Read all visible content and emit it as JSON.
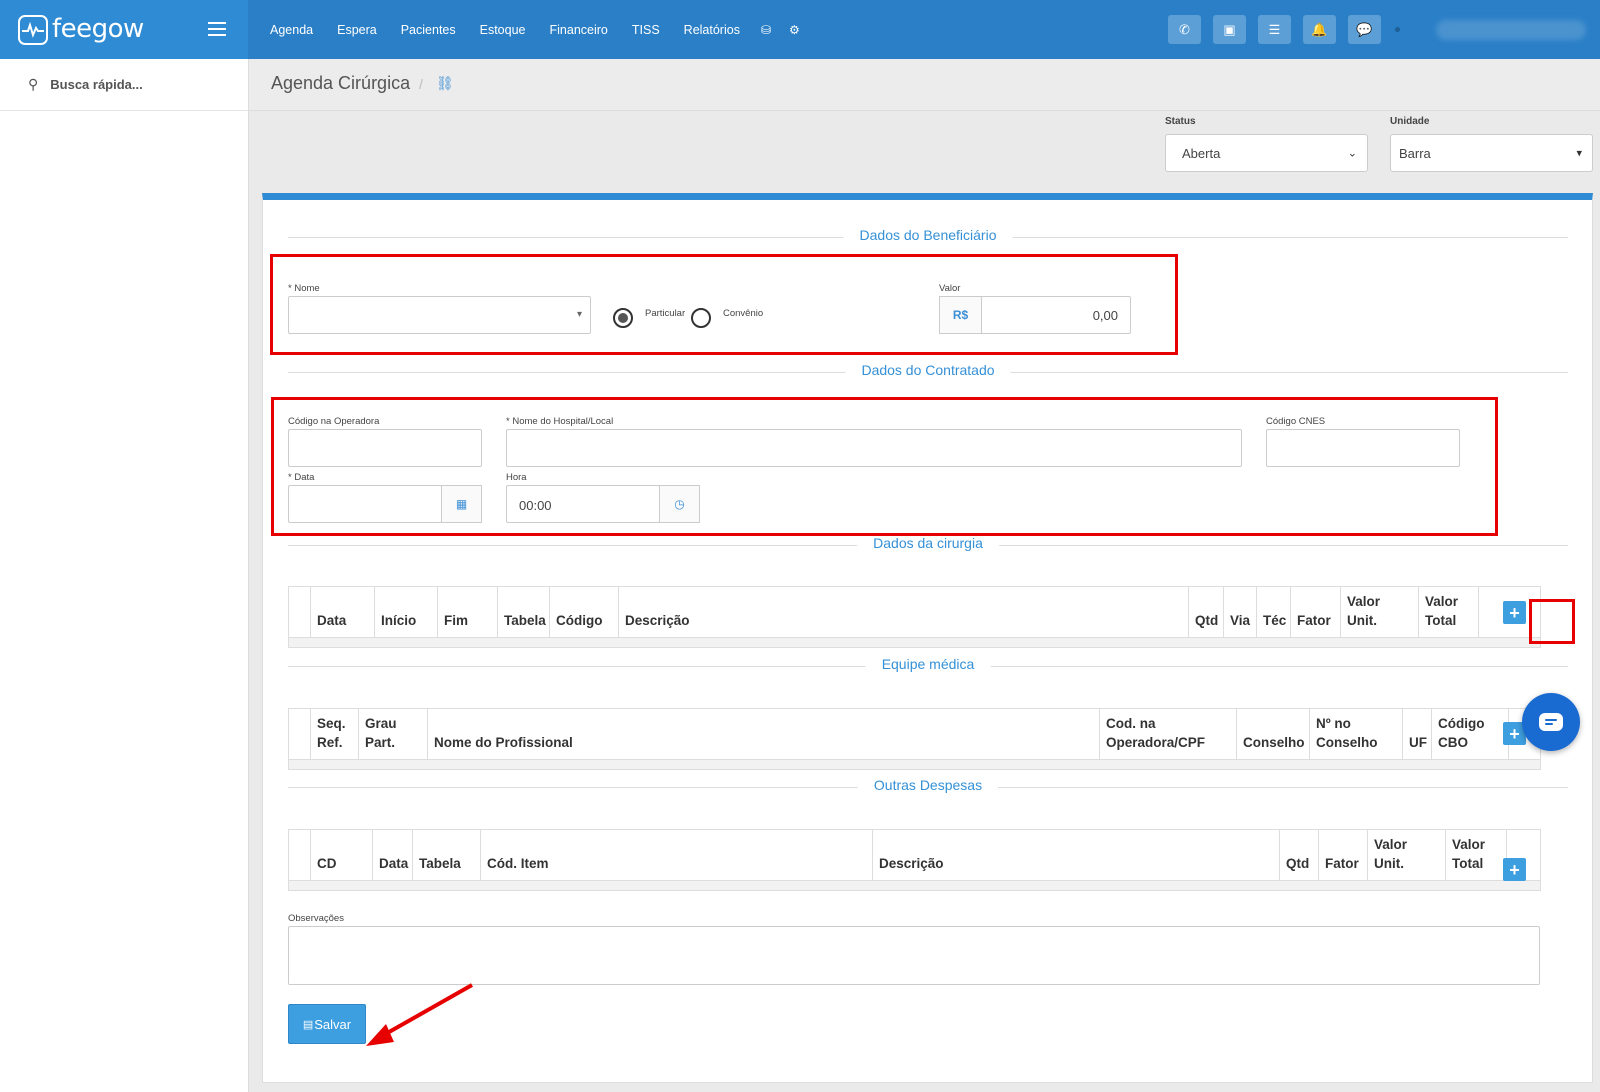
{
  "app": {
    "logo_text": "feegow"
  },
  "nav": {
    "items": [
      "Agenda",
      "Espera",
      "Pacientes",
      "Estoque",
      "Financeiro",
      "TISS",
      "Relatórios"
    ]
  },
  "topbar_icons": [
    "phone-icon",
    "inbox-icon",
    "list-icon",
    "bell-icon",
    "chat-icon"
  ],
  "sidebar": {
    "search_placeholder": "Busca rápida..."
  },
  "header": {
    "title": "Agenda Cirúrgica",
    "separator": "/"
  },
  "filters": {
    "status_label": "Status",
    "status_value": "Aberta",
    "unidade_label": "Unidade",
    "unidade_value": "Barra"
  },
  "beneficiario": {
    "section_title": "Dados do Beneficiário",
    "nome_label": "* Nome",
    "nome_value": "",
    "radio_particular": "Particular",
    "radio_convenio": "Convênio",
    "selected_radio": "Particular",
    "valor_label": "Valor",
    "valor_prefix": "R$",
    "valor_value": "0,00"
  },
  "contratado": {
    "section_title": "Dados do Contratado",
    "codigo_label": "Código na Operadora",
    "hospital_label": "* Nome do Hospital/Local",
    "cnes_label": "Código CNES",
    "data_label": "* Data",
    "hora_label": "Hora",
    "hora_value": "00:00"
  },
  "cirurgia": {
    "section_title": "Dados da cirurgia",
    "columns": [
      "Data",
      "Início",
      "Fim",
      "Tabela",
      "Código",
      "Descrição",
      "Qtd",
      "Via",
      "Téc",
      "Fator",
      "Valor Unit.",
      "Valor Total"
    ]
  },
  "equipe": {
    "section_title": "Equipe médica",
    "columns": [
      "Seq. Ref.",
      "Grau Part.",
      "Nome do Profissional",
      "Cod. na Operadora/CPF",
      "Conselho",
      "Nº no Conselho",
      "UF",
      "Código CBO"
    ]
  },
  "despesas": {
    "section_title": "Outras Despesas",
    "columns": [
      "CD",
      "Data",
      "Tabela",
      "Cód. Item",
      "Descrição",
      "Qtd",
      "Fator",
      "Valor Unit.",
      "Valor Total"
    ]
  },
  "observacoes": {
    "label": "Observações",
    "value": ""
  },
  "actions": {
    "save_label": "Salvar"
  },
  "colors": {
    "brand": "#2e8bd4",
    "accent": "#3590d6",
    "highlight": "#e60000"
  }
}
